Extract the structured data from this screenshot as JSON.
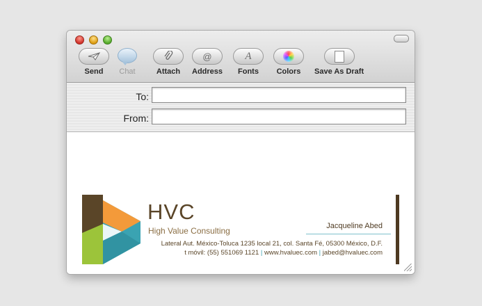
{
  "toolbar": {
    "buttons": [
      {
        "label": "Send",
        "icon": "send-icon"
      },
      {
        "label": "Chat",
        "icon": "chat-icon"
      },
      {
        "label": "Attach",
        "icon": "paperclip-icon"
      },
      {
        "label": "Address",
        "icon": "at-icon",
        "glyph": "@"
      },
      {
        "label": "Fonts",
        "icon": "fonts-icon",
        "glyph": "A"
      },
      {
        "label": "Colors",
        "icon": "color-wheel-icon"
      },
      {
        "label": "Save As Draft",
        "icon": "draft-icon"
      }
    ]
  },
  "header": {
    "to": {
      "label": "To:",
      "value": ""
    },
    "from": {
      "label": "From:",
      "value": ""
    }
  },
  "signature": {
    "company": "HVC",
    "tagline": "High Value Consulting",
    "name": "Jacqueline Abed",
    "address": "Lateral Aut. México-Toluca 1235 local 21, col. Santa Fé, 05300 México, D.F.",
    "phone": "t móvil: (55) 551069 1121",
    "web": "www.hvaluec.com",
    "email": "jabed@hvaluec.com",
    "separator": "|"
  },
  "colors": {
    "brand_brown": "#5a4528",
    "brand_teal": "#3aa3b2",
    "brand_orange": "#f39a3a",
    "brand_green": "#9cc43a"
  }
}
